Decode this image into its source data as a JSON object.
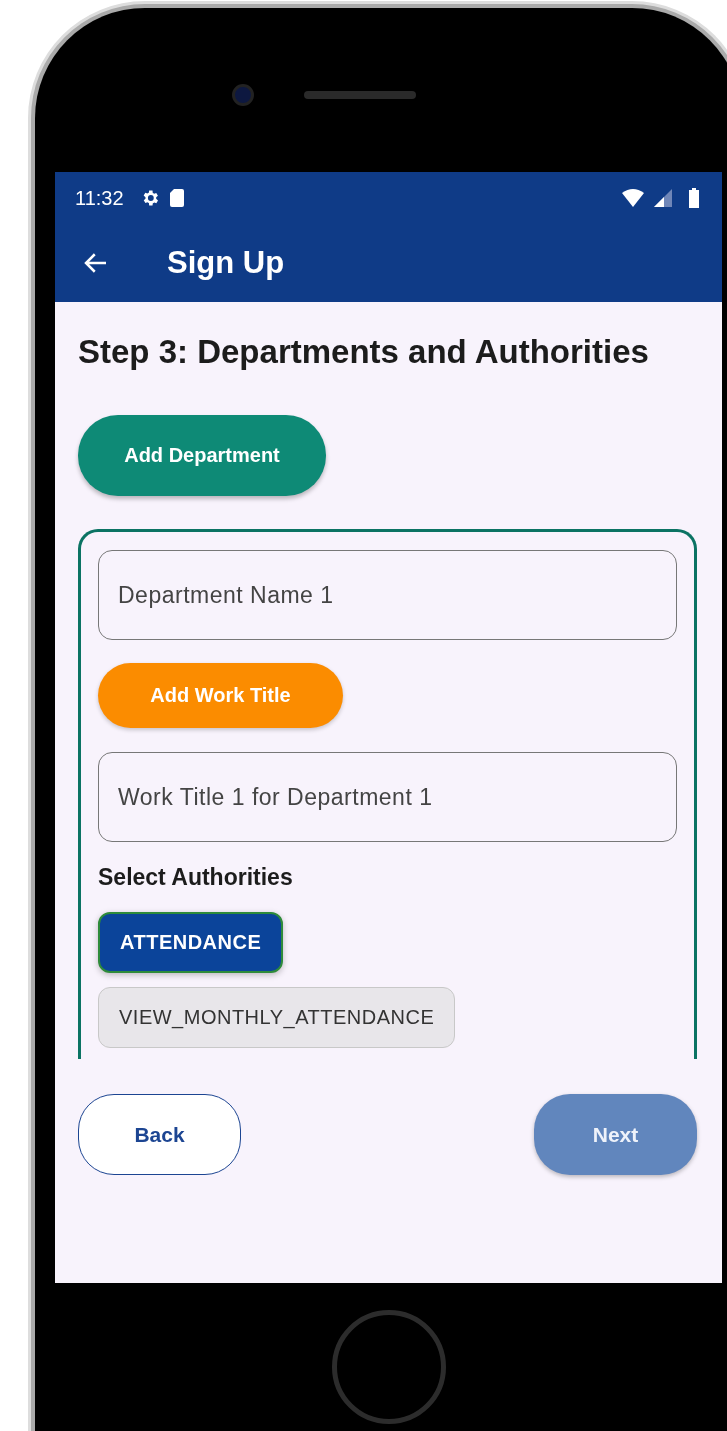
{
  "status_bar": {
    "time": "11:32"
  },
  "app_bar": {
    "title": "Sign Up"
  },
  "heading": "Step 3: Departments and Authorities",
  "add_department_button": "Add Department",
  "department_card": {
    "department_field": {
      "value": "Department Name 1"
    },
    "add_work_title_button": "Add Work Title",
    "work_title_field": {
      "value": "Work Title 1 for Department 1"
    },
    "authorities_label": "Select Authorities",
    "authorities": [
      {
        "label": "ATTENDANCE",
        "selected": true
      },
      {
        "label": "VIEW_MONTHLY_ATTENDANCE",
        "selected": false
      }
    ]
  },
  "footer": {
    "back_button": {
      "label": "Back",
      "disabled": false
    },
    "next_button": {
      "label": "Next",
      "disabled": true
    }
  }
}
